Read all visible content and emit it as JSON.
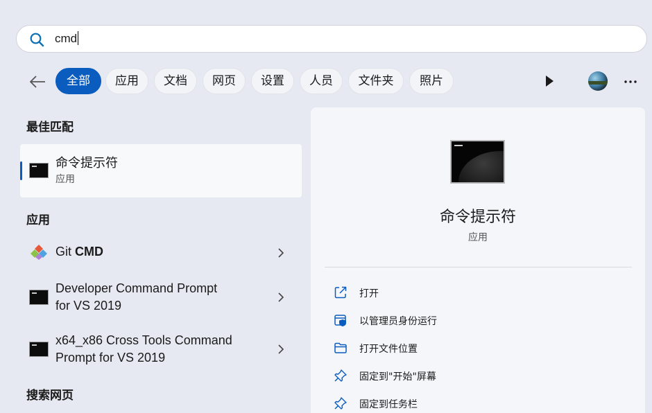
{
  "search": {
    "value": "cmd"
  },
  "filters": [
    "全部",
    "应用",
    "文档",
    "网页",
    "设置",
    "人员",
    "文件夹",
    "照片"
  ],
  "active_filter": "全部",
  "sections": {
    "best_match": "最佳匹配",
    "apps": "应用",
    "web": "搜索网页"
  },
  "best_match": {
    "title": "命令提示符",
    "subtitle": "应用"
  },
  "apps": [
    {
      "name_prefix": "Git ",
      "name_bold": "CMD"
    },
    {
      "line1": "Developer Command Prompt",
      "line2": "for VS 2019"
    },
    {
      "line1": "x64_x86 Cross Tools Command",
      "line2": "Prompt for VS 2019"
    }
  ],
  "detail": {
    "title": "命令提示符",
    "subtitle": "应用",
    "actions": [
      "打开",
      "以管理员身份运行",
      "打开文件位置",
      "固定到\"开始\"屏幕",
      "固定到任务栏"
    ]
  },
  "colors": {
    "accent": "#0a5cbf",
    "background": "#e6e9f1",
    "panel": "#f4f6f9"
  },
  "icons": [
    "search-icon",
    "back-arrow-icon",
    "play-icon",
    "avatar",
    "more-icon",
    "cmd-icon",
    "git-icon",
    "chevron-right-icon",
    "open-icon",
    "shield-admin-icon",
    "folder-icon",
    "pin-icon"
  ]
}
